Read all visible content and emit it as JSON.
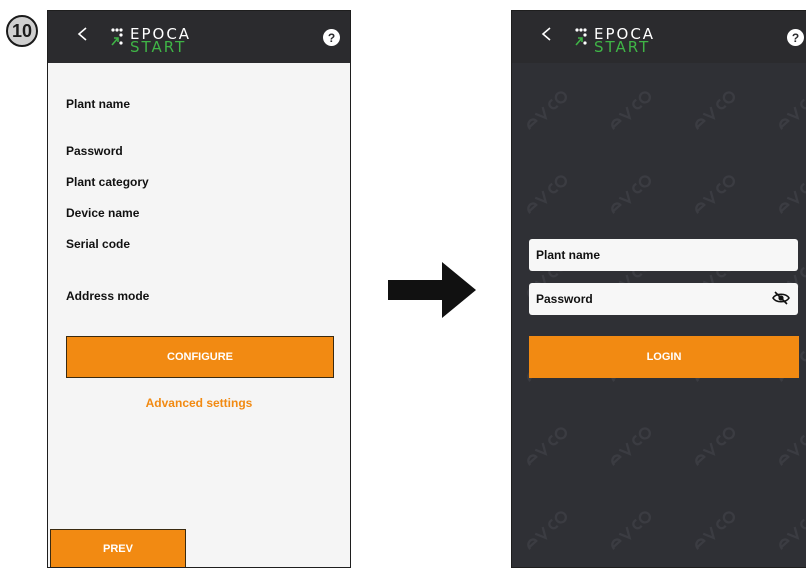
{
  "step": {
    "number": "10"
  },
  "app": {
    "logo_line1": "EPOCA",
    "logo_line2": "START",
    "help_glyph": "?",
    "back_icon": "chevron-left-icon",
    "accent_color": "#f28a12",
    "brand_green": "#3fb446"
  },
  "configure_screen": {
    "fields": [
      {
        "label": "Plant name"
      },
      {
        "label": "Password"
      },
      {
        "label": "Plant category"
      },
      {
        "label": "Device name"
      },
      {
        "label": "Serial code"
      },
      {
        "label": "Address mode"
      }
    ],
    "configure_button": "CONFIGURE",
    "advanced_link": "Advanced settings",
    "prev_button": "PREV"
  },
  "login_screen": {
    "plant_name_placeholder": "Plant name",
    "password_placeholder": "Password",
    "login_button": "LOGIN",
    "password_icon": "eye-slash-icon"
  }
}
